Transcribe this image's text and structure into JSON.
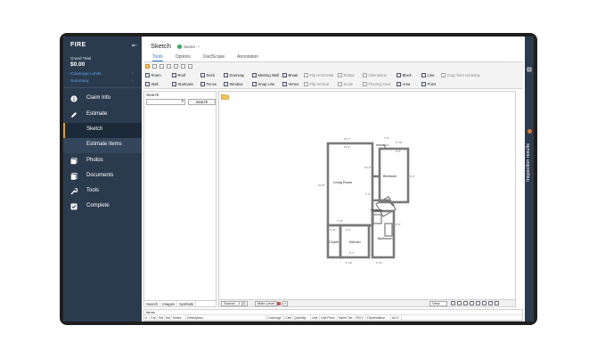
{
  "sidebar": {
    "app_name": "FIRE",
    "grand_total_label": "Grand Total",
    "grand_total_value": "$0.00",
    "coverage_limits": "Coverage Limits",
    "summary": "Summary",
    "nav": [
      {
        "label": "Claim Info",
        "icon": "info-icon"
      },
      {
        "label": "Estimate",
        "icon": "pencil-icon"
      },
      {
        "label": "Sketch",
        "icon": ""
      },
      {
        "label": "Estimate Items",
        "icon": ""
      },
      {
        "label": "Photos",
        "icon": "photos-icon"
      },
      {
        "label": "Documents",
        "icon": "documents-icon"
      },
      {
        "label": "Tools",
        "icon": "wrench-icon"
      },
      {
        "label": "Complete",
        "icon": "checkbox-icon"
      }
    ]
  },
  "header": {
    "title": "Sketch",
    "saved": "Saved"
  },
  "tabs": [
    "Tools",
    "Options",
    "XactScope",
    "Annotation"
  ],
  "toolbar": {
    "row1": [
      "Room",
      "Roof",
      "Deck",
      "Doorway",
      "Missing Wall",
      "Break",
      "Flip Horizontal",
      "Rotate",
      "Orientation",
      "Block",
      "Line",
      "Copy from Underlay"
    ],
    "row2": [
      "Wall",
      "Staircase",
      "Fence",
      "Window",
      "Snap Line",
      "Vertex",
      "Flip Vertical",
      "Scale",
      "Flooring Over",
      "Area",
      "Point"
    ]
  },
  "left_panel": {
    "header": "Search",
    "search_button": "Search",
    "tabs": [
      "Search",
      "Images",
      "Symbols"
    ]
  },
  "canvas": {
    "level_select": "Source - 1 (2)",
    "level_tab": "Main Level",
    "view_select": "View",
    "plan": {
      "rooms": [
        "Living Room",
        "Bedroom",
        "Hallway",
        "Closet",
        "Kitchen",
        "Bathroom"
      ],
      "dims": [
        "14' 7\"",
        "11' 9\"",
        "7' 9\"",
        "5' 10\"",
        "5' 11\"",
        "5' 8\"",
        "9' 2\"",
        "21' 8\"",
        "12' 4\"",
        "7' 11\"",
        "3' 11\"",
        "4' 9\"",
        "3' 7\"",
        "5' 10\"",
        "6' 5\"",
        "3' 11\"",
        "7' 2\""
      ]
    }
  },
  "items": {
    "title": "Items",
    "columns": [
      "#",
      "Cat",
      "Sel",
      "Act",
      "Notes",
      "Description",
      "Coverage",
      "Calc",
      "Quantity",
      "Unit",
      "Unit Price",
      "Sales Tax",
      "RCV",
      "Depreciation",
      "ACV"
    ]
  },
  "rail": {
    "label": "Inspection results"
  }
}
